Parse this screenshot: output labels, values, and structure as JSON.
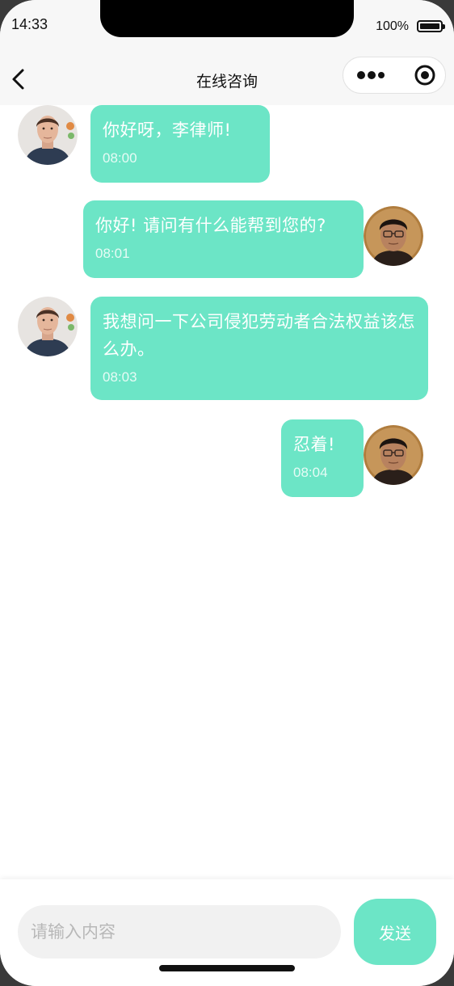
{
  "status_bar": {
    "time": "14:33",
    "battery": "100%"
  },
  "nav": {
    "title": "在线咨询",
    "back_icon": "chevron-left-icon",
    "more_icon": "more-dots-icon",
    "close_icon": "target-close-icon"
  },
  "messages": [
    {
      "side": "left",
      "sender": "client",
      "text": "你好呀，李律师!",
      "time": "08:00"
    },
    {
      "side": "right",
      "sender": "lawyer",
      "text": "你好! 请问有什么能帮到您的?",
      "time": "08:01"
    },
    {
      "side": "left",
      "sender": "client",
      "text": "我想问一下公司侵犯劳动者合法权益该怎么办。",
      "time": "08:03"
    },
    {
      "side": "right",
      "sender": "lawyer",
      "text": "忍着!",
      "time": "08:04"
    }
  ],
  "input": {
    "placeholder": "请输入内容",
    "value": ""
  },
  "send_label": "发送",
  "colors": {
    "accent": "#6ce5c6",
    "bar_background": "#f7f7f7"
  }
}
